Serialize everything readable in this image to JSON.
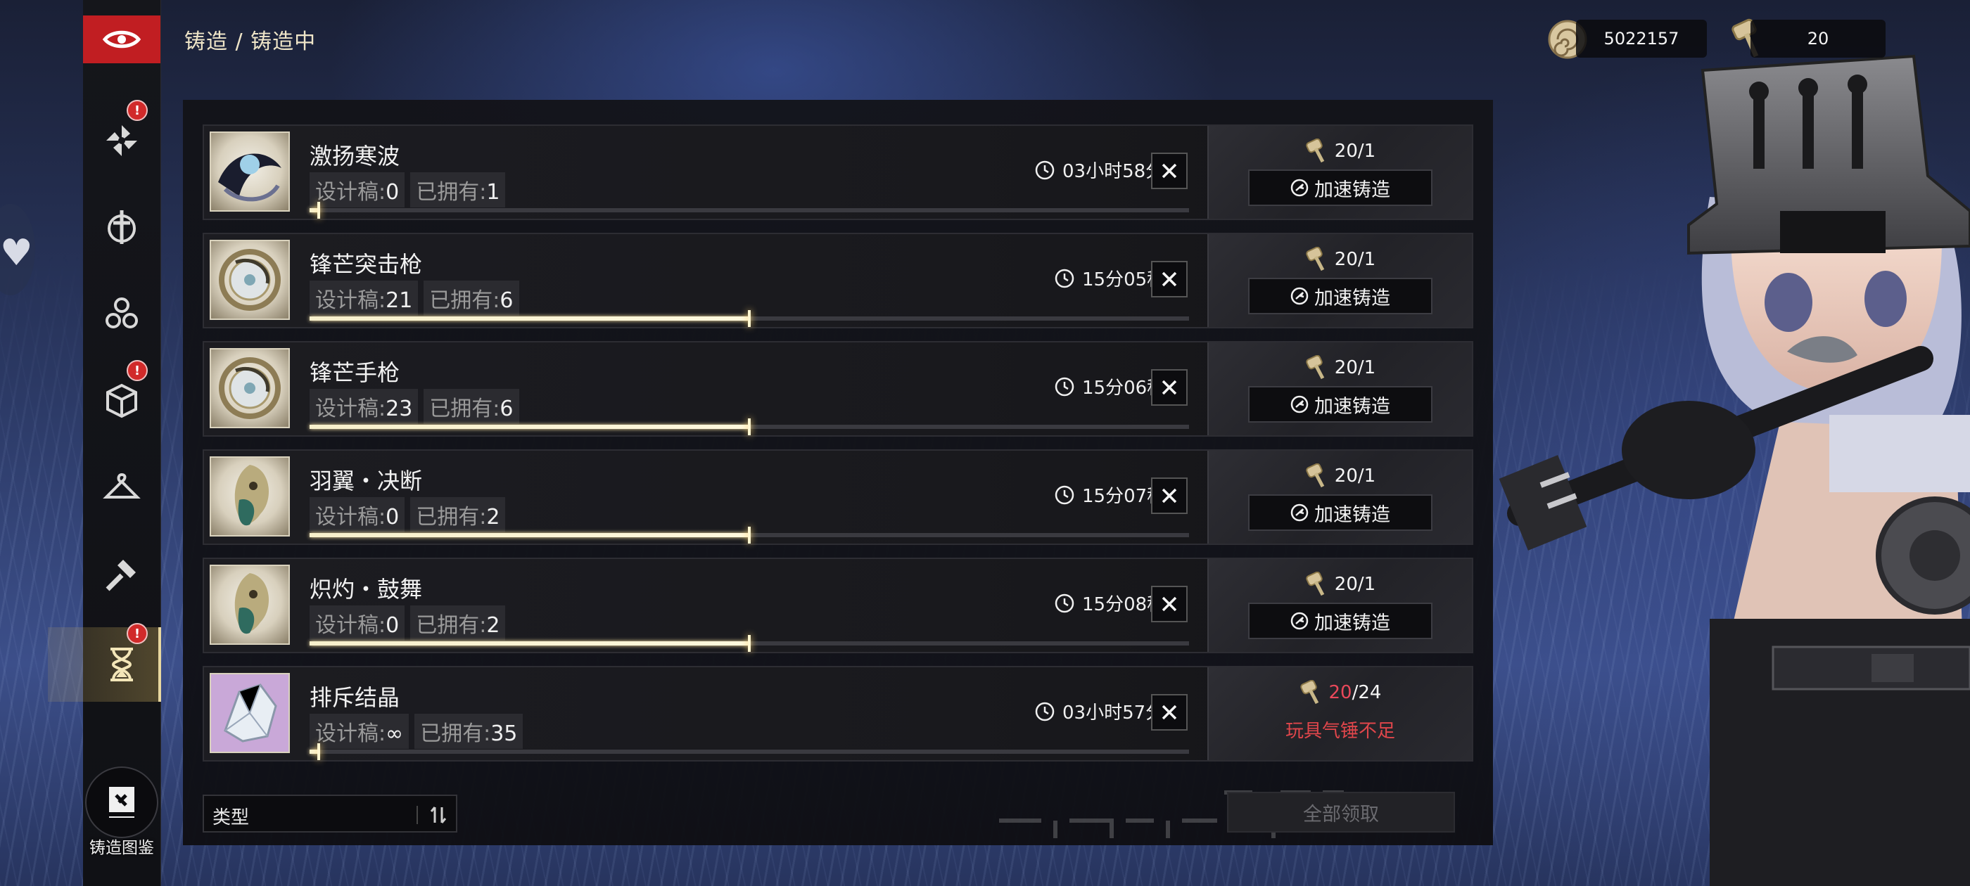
{
  "header": {
    "breadcrumb": "铸造 / 铸造中"
  },
  "resources": [
    {
      "icon": "shell-coin-icon",
      "value": "5022157"
    },
    {
      "icon": "toy-hammer-icon",
      "value": "20"
    }
  ],
  "sidebar": {
    "items": [
      {
        "icon": "pinwheel-icon",
        "badge": "!"
      },
      {
        "icon": "sword-emblem-icon",
        "badge": ""
      },
      {
        "icon": "triangle-rings-icon",
        "badge": ""
      },
      {
        "icon": "cube-icon",
        "badge": "!"
      },
      {
        "icon": "hanger-icon",
        "badge": ""
      },
      {
        "icon": "hammer-anvil-icon",
        "badge": ""
      },
      {
        "icon": "hourglass-icon",
        "badge": "!"
      }
    ],
    "codex_label": "铸造图鉴"
  },
  "labels": {
    "design_prefix": "设计稿:",
    "owned_prefix": "已拥有:",
    "speed_up": "加速铸造",
    "insufficient": "玩具气锤不足"
  },
  "queue": [
    {
      "name": "激扬寒波",
      "design": "0",
      "owned": "1",
      "time": "03小时58分",
      "cost_have": "20",
      "cost_need": "1",
      "progress": 0.01,
      "thumb": "blue-wave-relic"
    },
    {
      "name": "锋芒突击枪",
      "design": "21",
      "owned": "6",
      "time": "15分05秒",
      "cost_have": "20",
      "cost_need": "1",
      "progress": 0.5,
      "thumb": "gold-ring-relic"
    },
    {
      "name": "锋芒手枪",
      "design": "23",
      "owned": "6",
      "time": "15分06秒",
      "cost_have": "20",
      "cost_need": "1",
      "progress": 0.5,
      "thumb": "gold-ring-relic"
    },
    {
      "name": "羽翼・决断",
      "design": "0",
      "owned": "2",
      "time": "15分07秒",
      "cost_have": "20",
      "cost_need": "1",
      "progress": 0.5,
      "thumb": "green-mask-relic"
    },
    {
      "name": "炽灼・鼓舞",
      "design": "0",
      "owned": "2",
      "time": "15分08秒",
      "cost_have": "20",
      "cost_need": "1",
      "progress": 0.5,
      "thumb": "green-mask-relic"
    },
    {
      "name": "排斥结晶",
      "design": "∞",
      "owned": "35",
      "time": "03小时57分",
      "cost_have": "20",
      "cost_need": "24",
      "progress": 0.01,
      "thumb": "crystal-relic",
      "insufficient": true
    }
  ],
  "footer": {
    "type_filter": "类型",
    "claim_all": "全部领取"
  },
  "colors": {
    "accent_red": "#c11e22",
    "warning": "#e0464b",
    "gold": "#efe5c8"
  }
}
